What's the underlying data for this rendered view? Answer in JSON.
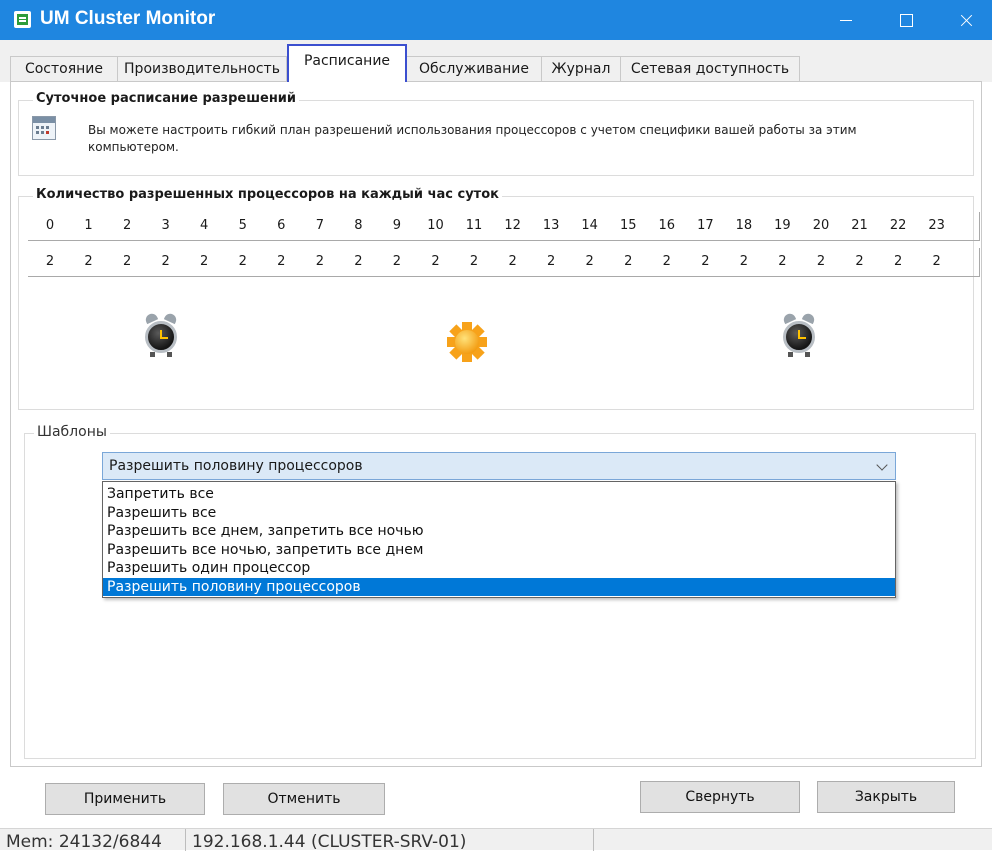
{
  "window": {
    "title": "UM Cluster Monitor"
  },
  "tabs": [
    {
      "label": "Состояние"
    },
    {
      "label": "Производительность"
    },
    {
      "label": "Расписание"
    },
    {
      "label": "Обслуживание"
    },
    {
      "label": "Журнал"
    },
    {
      "label": "Сетевая доступность"
    }
  ],
  "daily_schedule": {
    "title": "Суточное расписание разрешений",
    "info_line1": "Вы можете настроить гибкий план разрешений использования процессоров с учетом специфики вашей работы за этим",
    "info_line2": "компьютером."
  },
  "hourly": {
    "title": "Количество разрешенных процессоров на каждый час суток",
    "hours": [
      "0",
      "1",
      "2",
      "3",
      "4",
      "5",
      "6",
      "7",
      "8",
      "9",
      "10",
      "11",
      "12",
      "13",
      "14",
      "15",
      "16",
      "17",
      "18",
      "19",
      "20",
      "21",
      "22",
      "23"
    ],
    "values": [
      "2",
      "2",
      "2",
      "2",
      "2",
      "2",
      "2",
      "2",
      "2",
      "2",
      "2",
      "2",
      "2",
      "2",
      "2",
      "2",
      "2",
      "2",
      "2",
      "2",
      "2",
      "2",
      "2",
      "2"
    ]
  },
  "templates": {
    "title": "Шаблоны",
    "selected": "Разрешить половину процессоров",
    "options": [
      "Запретить все",
      "Разрешить все",
      "Разрешить все днем, запретить все ночью",
      "Разрешить все ночью, запретить все днем",
      "Разрешить один процессор",
      "Разрешить половину процессоров"
    ],
    "selected_index": 5
  },
  "buttons": {
    "apply": "Применить",
    "cancel": "Отменить",
    "minimize": "Свернуть",
    "close": "Закрыть"
  },
  "status": {
    "memory": "Mem: 24132/6844",
    "host": "192.168.1.44 (CLUSTER-SRV-01)"
  },
  "icons": {
    "app": "cluster-app-icon",
    "calendar": "calendar-icon",
    "night_start": "alarm-clock-icon",
    "day": "sun-icon",
    "night_end": "alarm-clock-icon"
  },
  "colors": {
    "titlebar": "#1f86e0",
    "active_tab_border": "#3b4fcf",
    "selection": "#0078d7"
  }
}
